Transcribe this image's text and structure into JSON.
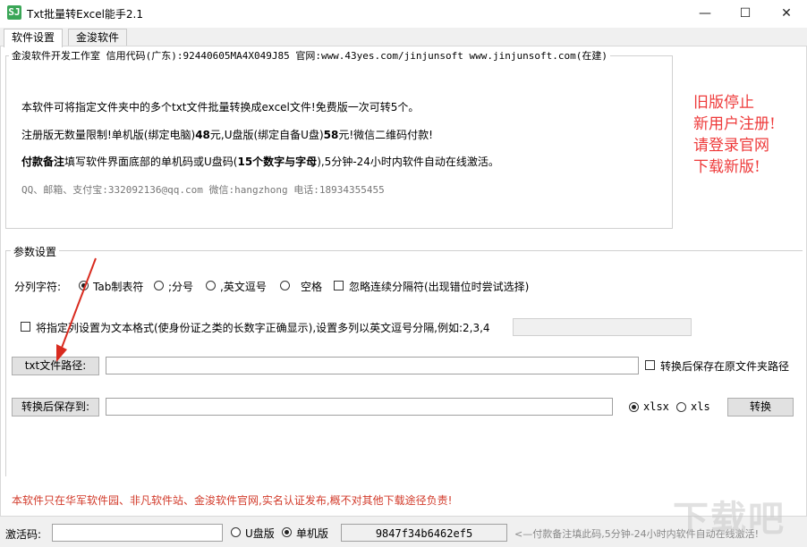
{
  "window": {
    "icon_glyph": "SJ",
    "title": "Txt批量转Excel能手2.1",
    "minimize_glyph": "—",
    "maximize_glyph": "☐",
    "close_glyph": "✕"
  },
  "tabs": [
    {
      "label": "软件设置",
      "active": true
    },
    {
      "label": "金浚软件",
      "active": false
    }
  ],
  "info": {
    "header": "金浚软件开发工作室 信用代码(广东):92440605MA4X049J85 官网:www.43yes.com/jinjunsoft  www.jinjunsoft.com(在建)",
    "line1": "本软件可将指定文件夹中的多个txt文件批量转换成excel文件!免费版一次可转5个。",
    "line2_a": "注册版无数量限制!单机版(绑定电脑)",
    "line2_b": "48",
    "line2_c": "元,U盘版(绑定自备U盘)",
    "line2_d": "58",
    "line2_e": "元!微信二维码付款!",
    "line3_a": "付款备注",
    "line3_b": "填写软件界面底部的单机码或U盘码(",
    "line3_c": "15个数字与字母",
    "line3_d": "),5分钟-24小时内软件自动在线激活。",
    "contact": "QQ、邮箱、支付宝:332092136@qq.com  微信:hangzhong  电话:18934355455",
    "notice_lines": [
      "旧版停止",
      "新用户注册!",
      "请登录官网",
      "下载新版!"
    ],
    "notice_color": "#ee3a3a"
  },
  "params": {
    "legend": "参数设置",
    "split_label": "分列字符:",
    "options": [
      {
        "label": "Tab制表符",
        "selected": true
      },
      {
        "label": ";分号",
        "selected": false
      },
      {
        "label": ",英文逗号",
        "selected": false
      },
      {
        "label": "空格",
        "selected": false
      }
    ],
    "ignore_consecutive": "忽略连续分隔符(出现错位时尝试选择)",
    "text_format_check": "将指定列设置为文本格式(使身份证之类的长数字正确显示),设置多列以英文逗号分隔,例如:2,3,4",
    "text_format_value": "",
    "txt_path_button": "txt文件路径:",
    "txt_path_value": "",
    "save_in_original": "转换后保存在原文件夹路径",
    "save_to_button": "转换后保存到:",
    "save_to_value": "",
    "format_options": [
      {
        "label": "xlsx",
        "selected": true
      },
      {
        "label": "xls",
        "selected": false
      }
    ],
    "convert_button": "转换"
  },
  "footer_notice": "本软件只在华军软件园、非凡软件站、金浚软件官网,实名认证发布,概不对其他下载途径负责!",
  "footer_notice_color": "#d23a2a",
  "bottom": {
    "activation_label": "激活码:",
    "activation_value": "",
    "usb_option": "U盘版",
    "standalone_option": "单机版",
    "machine_code": "9847f34b6462ef5",
    "hint": "<—付款备注填此码,5分钟-24小时内软件自动在线激活!"
  },
  "watermark": "下载吧"
}
